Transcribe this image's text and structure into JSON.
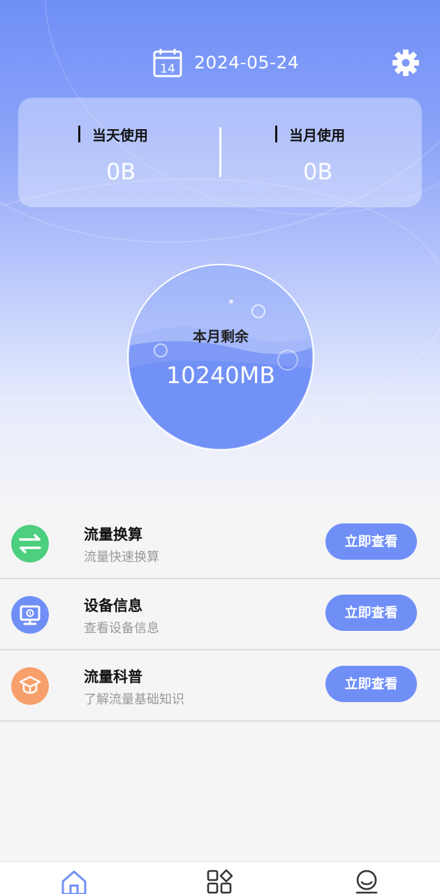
{
  "header": {
    "date": "2024-05-24",
    "calendar_day": "14",
    "calendar_icon": "calendar-icon",
    "settings_icon": "gear-icon"
  },
  "usage": {
    "today_label": "当天使用",
    "today_value": "0B",
    "month_label": "当月使用",
    "month_value": "0B"
  },
  "remaining": {
    "label": "本月剩余",
    "value": "10240MB"
  },
  "features": [
    {
      "title": "流量换算",
      "subtitle": "流量快速换算",
      "button": "立即查看",
      "icon": "exchange-arrows-icon",
      "color": "#4ccf7e"
    },
    {
      "title": "设备信息",
      "subtitle": "查看设备信息",
      "button": "立即查看",
      "icon": "monitor-icon",
      "color": "#6f8ff7"
    },
    {
      "title": "流量科普",
      "subtitle": "了解流量基础知识",
      "button": "立即查看",
      "icon": "graduation-cap-icon",
      "color": "#f8a06c"
    }
  ],
  "nav": [
    {
      "icon": "home-icon"
    },
    {
      "icon": "apps-grid-icon"
    },
    {
      "icon": "profile-icon"
    }
  ],
  "colors": {
    "accent": "#6f8ff7",
    "background": "#f5f5f5"
  }
}
